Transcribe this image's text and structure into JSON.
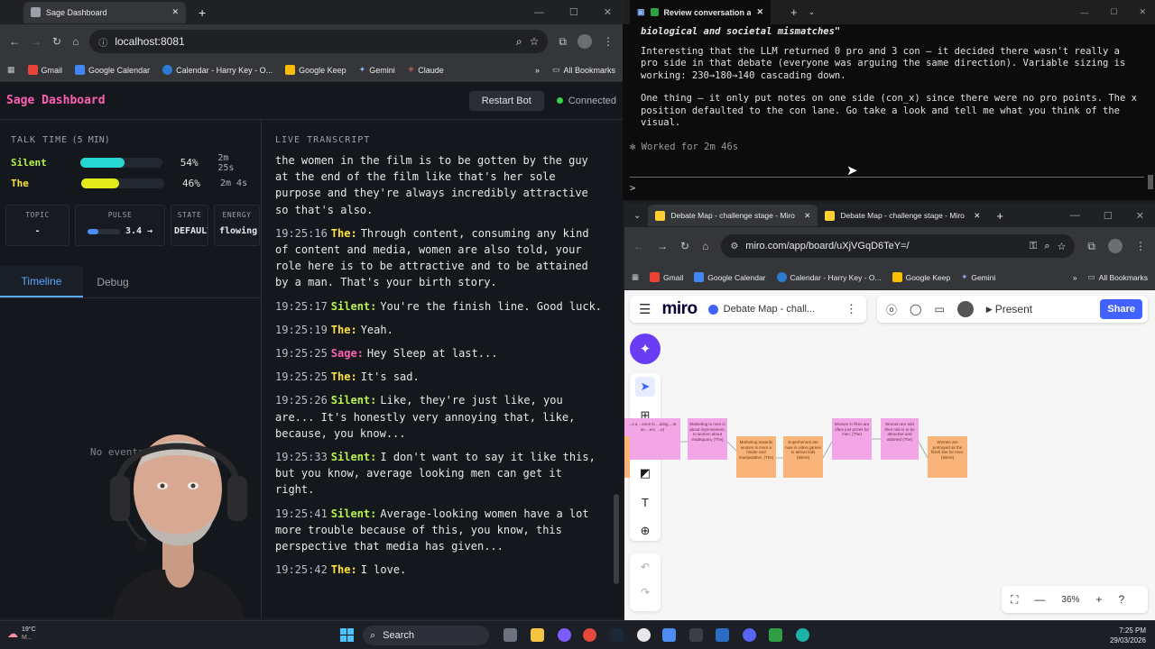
{
  "left_browser": {
    "tab_title": "Sage Dashboard",
    "url": "localhost:8081",
    "bookmarks": [
      "Gmail",
      "Google Calendar",
      "Calendar - Harry Key - O...",
      "Google Keep",
      "Gemini",
      "Claude"
    ],
    "all_bookmarks": "All Bookmarks"
  },
  "sage": {
    "title": "Sage Dashboard",
    "restart_label": "Restart Bot",
    "status": "Connected",
    "talk_time_label": "TALK TIME",
    "talk_time_window": "(5 MIN)",
    "speakers": [
      {
        "name": "Silent",
        "percent": "54%",
        "fraction": 0.54,
        "duration": "2m 25s",
        "color": "#27d6d0"
      },
      {
        "name": "The",
        "percent": "46%",
        "fraction": 0.46,
        "duration": "2m 4s",
        "color": "#e3ea1a"
      }
    ],
    "stats": {
      "topic_label": "TOPIC",
      "topic_value": "-",
      "pulse_label": "PULSE",
      "pulse_value": "3.4 →",
      "pulse_fraction": 0.34,
      "state_label": "STATE",
      "state_value": "DEFAULT",
      "energy_label": "ENERGY",
      "energy_value": "flowing"
    },
    "tabs": [
      "Timeline",
      "Debug"
    ],
    "timeline_empty": "No events yet",
    "transcript_label": "LIVE TRANSCRIPT",
    "transcript_intro": "the women in the film is to be gotten by the guy at the end of the film like that's her sole purpose and they're always incredibly attractive so that's also.",
    "transcript": [
      {
        "time": "19:25:16",
        "speaker": "The:",
        "cls": "the",
        "text": "Through content, consuming any kind of content and media, women are also told, your role here is to be attractive and to be attained by a man. That's your birth story."
      },
      {
        "time": "19:25:17",
        "speaker": "Silent:",
        "cls": "silent",
        "text": "You're the finish line. Good luck."
      },
      {
        "time": "19:25:19",
        "speaker": "The:",
        "cls": "the",
        "text": "Yeah."
      },
      {
        "time": "19:25:25",
        "speaker": "Sage:",
        "cls": "sage",
        "text": "Hey Sleep at last..."
      },
      {
        "time": "19:25:25",
        "speaker": "The:",
        "cls": "the",
        "text": "It's sad."
      },
      {
        "time": "19:25:26",
        "speaker": "Silent:",
        "cls": "silent",
        "text": "Like, they're just like, you are... It's honestly very annoying that, like, because, you know..."
      },
      {
        "time": "19:25:33",
        "speaker": "Silent:",
        "cls": "silent",
        "text": "I don't want to say it like this, but you know, average looking men can get it right."
      },
      {
        "time": "19:25:41",
        "speaker": "Silent:",
        "cls": "silent",
        "text": "Average-looking women have a lot more trouble because of this, you know, this perspective that media has given..."
      },
      {
        "time": "19:25:42",
        "speaker": "The:",
        "cls": "the",
        "text": "I love."
      }
    ]
  },
  "terminal": {
    "tab_title": "Review conversation a",
    "line1": "biological and societal mismatches\"",
    "para1": "Interesting that the LLM returned 0 pro and 3 con — it decided there wasn't really a pro side in that debate (everyone was arguing the same direction). Variable sizing is working: 230→180→140 cascading down.",
    "para2": "One thing — it only put notes on one side (con_x) since there were no pro points. The x position defaulted to the con lane. Go take a look and tell me what you think of the visual.",
    "worked": "✻ Worked for 2m 46s",
    "prompt": ">"
  },
  "right_browser": {
    "tab1": "Debate Map - challenge stage - Miro",
    "tab2": "Debate Map - challenge stage - Miro",
    "url": "miro.com/app/board/uXjVGqD6TeY=/",
    "bookmarks": [
      "Gmail",
      "Google Calendar",
      "Calendar - Harry Key - O...",
      "Google Keep",
      "Gemini"
    ],
    "all_bookmarks": "All Bookmarks"
  },
  "miro": {
    "logo": "miro",
    "board_name": "Debate Map - chall...",
    "present_label": "Present",
    "share_label": "Share",
    "zoom": "36%",
    "notes": [
      {
        "text": "...s a ...ence in ...ating ...nt an ...ers. ...e)",
        "color": "pink"
      },
      {
        "text": "Marketing to men is about improvement, to women about inadequacy (The)",
        "color": "pink"
      },
      {
        "text": "Marketing towards women is more a hinder and manipulative. (The)",
        "color": "orange"
      },
      {
        "text": "Superheroes are now in video games to attract kids (Silent)",
        "color": "orange"
      },
      {
        "text": "Women in films are often just prizes for men. (The)",
        "color": "pink"
      },
      {
        "text": "Women are told their role is to be attractive and attained (The)",
        "color": "pink"
      },
      {
        "text": "Women are portrayed as the finish line for men. (Silent)",
        "color": "orange"
      }
    ]
  },
  "taskbar": {
    "weather": "19°C",
    "weather_sub": "M...",
    "search": "Search",
    "time": "7:25 PM",
    "date": "29/03/2026"
  }
}
